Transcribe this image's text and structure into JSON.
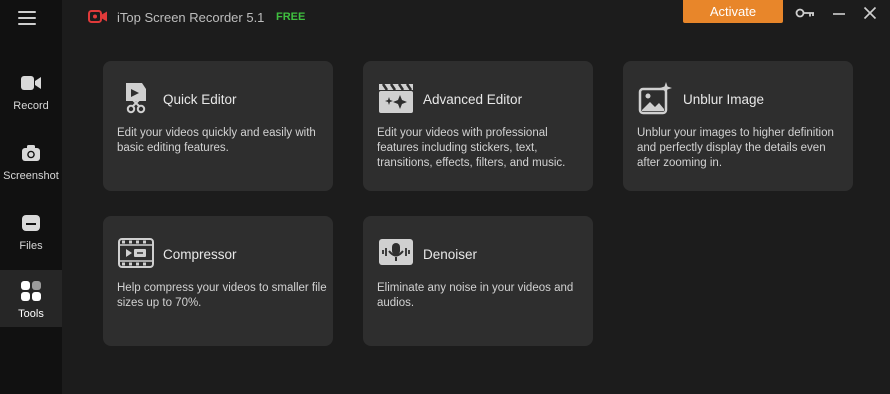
{
  "app": {
    "title": "iTop Screen Recorder 5.1",
    "badge": "FREE",
    "activate_label": "Activate"
  },
  "sidebar": {
    "items": [
      {
        "label": "Record",
        "icon": "camcorder-icon"
      },
      {
        "label": "Screenshot",
        "icon": "camera-icon"
      },
      {
        "label": "Files",
        "icon": "folder-icon"
      },
      {
        "label": "Tools",
        "icon": "grid-icon",
        "active": true
      }
    ]
  },
  "tools": [
    {
      "title": "Quick Editor",
      "desc": "Edit your videos quickly and easily with basic editing features.",
      "icon": "quick-editor-icon"
    },
    {
      "title": "Advanced Editor",
      "desc": "Edit your videos with professional features including stickers, text, transitions, effects, filters, and music.",
      "icon": "clapperboard-icon"
    },
    {
      "title": "Unblur Image",
      "desc": "Unblur your images to higher definition and perfectly display the details even after zooming in.",
      "icon": "image-sparkle-icon"
    },
    {
      "title": "Compressor",
      "desc": "Help compress your videos to smaller file sizes up to 70%.",
      "icon": "compress-icon"
    },
    {
      "title": "Denoiser",
      "desc": "Eliminate any noise in your videos and audios.",
      "icon": "denoise-icon"
    }
  ],
  "colors": {
    "accent": "#e8862a",
    "free_badge": "#3fbf3f",
    "logo": "#e03a3a",
    "card_bg": "#2e2e2e",
    "sidebar_bg": "#111111"
  }
}
